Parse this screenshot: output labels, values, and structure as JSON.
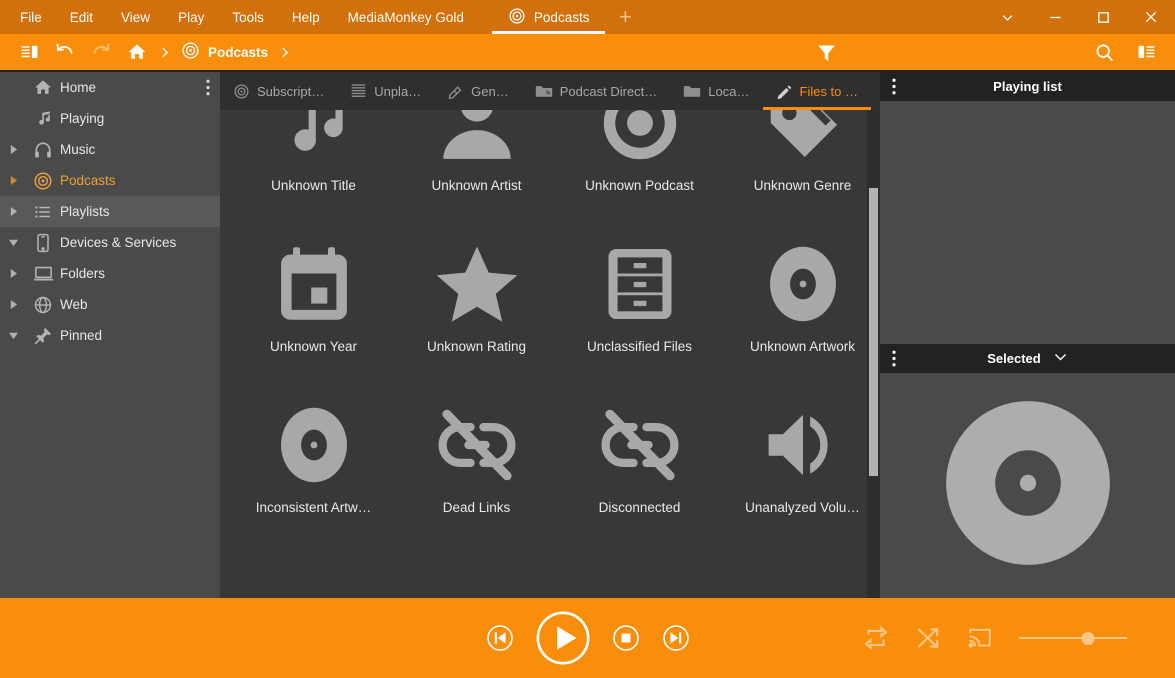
{
  "app": {
    "title": "MediaMonkey Gold",
    "accent": "#f98e0b",
    "menubar_bg": "#d2700a",
    "sidebar_bg": "#4a4a4a",
    "content_bg": "#383838",
    "panel_header_bg": "#222222"
  },
  "menubar": {
    "items": [
      {
        "label": "File",
        "icon": ""
      },
      {
        "label": "Edit",
        "icon": ""
      },
      {
        "label": "View",
        "icon": ""
      },
      {
        "label": "Play",
        "icon": ""
      },
      {
        "label": "Tools",
        "icon": ""
      },
      {
        "label": "Help",
        "icon": ""
      },
      {
        "label": "MediaMonkey Gold",
        "icon": ""
      }
    ],
    "window_tabs": [
      {
        "label": "Podcasts",
        "icon": "podcast-icon",
        "active": true
      }
    ],
    "add_tab_label": "+",
    "window_controls": [
      {
        "name": "chevron-down-icon"
      },
      {
        "name": "minimize-icon"
      },
      {
        "name": "maximize-icon"
      },
      {
        "name": "close-icon"
      }
    ]
  },
  "toolbar": {
    "panel_toggle_icon": "left-panel-toggle-icon",
    "undo_icon": "undo-icon",
    "redo_icon": "redo-icon",
    "home_icon": "home-icon",
    "breadcrumb": [
      {
        "label": "Podcasts",
        "icon": "podcast-icon"
      }
    ],
    "filter_icon": "filter-funnel-icon",
    "search_icon": "search-icon",
    "right_panel_toggle_icon": "right-panel-toggle-icon"
  },
  "sidebar": {
    "kebab_icon": "more-vertical-icon",
    "items": [
      {
        "label": "Home",
        "icon": "home-icon",
        "arrow": "none",
        "state": "normal"
      },
      {
        "label": "Playing",
        "icon": "music-note-icon",
        "arrow": "none",
        "state": "normal"
      },
      {
        "label": "Music",
        "icon": "headphones-icon",
        "arrow": "collapsed",
        "state": "normal"
      },
      {
        "label": "Podcasts",
        "icon": "podcast-icon",
        "arrow": "collapsed",
        "state": "active"
      },
      {
        "label": "Playlists",
        "icon": "list-icon",
        "arrow": "collapsed",
        "state": "selected"
      },
      {
        "label": "Devices & Services",
        "icon": "phone-icon",
        "arrow": "expanded",
        "state": "normal"
      },
      {
        "label": "Folders",
        "icon": "folder-laptop-icon",
        "arrow": "collapsed",
        "state": "normal"
      },
      {
        "label": "Web",
        "icon": "globe-icon",
        "arrow": "collapsed",
        "state": "normal"
      },
      {
        "label": "Pinned",
        "icon": "pin-icon",
        "arrow": "expanded",
        "state": "normal"
      }
    ]
  },
  "content": {
    "tabs": [
      {
        "label": "Subscript…",
        "icon": "podcast-icon",
        "active": false
      },
      {
        "label": "Unpla…",
        "icon": "lines-icon",
        "active": false
      },
      {
        "label": "Gen…",
        "icon": "pencil-tag-icon",
        "active": false
      },
      {
        "label": "Podcast Direct…",
        "icon": "folder-podcast-icon",
        "active": false
      },
      {
        "label": "Loca…",
        "icon": "folder-icon",
        "active": false
      },
      {
        "label": "Files to …",
        "icon": "pencil-icon",
        "active": true
      }
    ],
    "tiles": [
      {
        "label": "Unknown Title",
        "icon": "music-note-icon"
      },
      {
        "label": "Unknown Artist",
        "icon": "artist-icon"
      },
      {
        "label": "Unknown Podcast",
        "icon": "podcast-icon"
      },
      {
        "label": "Unknown Genre",
        "icon": "genre-tag-icon"
      },
      {
        "label": "Unknown Year",
        "icon": "calendar-icon"
      },
      {
        "label": "Unknown Rating",
        "icon": "star-icon"
      },
      {
        "label": "Unclassified Files",
        "icon": "file-cabinet-icon"
      },
      {
        "label": "Unknown Artwork",
        "icon": "disc-icon"
      },
      {
        "label": "Inconsistent Artw…",
        "icon": "disc-icon"
      },
      {
        "label": "Dead Links",
        "icon": "broken-link-icon"
      },
      {
        "label": "Disconnected",
        "icon": "broken-link-icon"
      },
      {
        "label": "Unanalyzed Volu…",
        "icon": "speaker-icon"
      }
    ],
    "scrollbar_name": "content-vertical-scrollbar"
  },
  "right_panel": {
    "playing_list": {
      "title": "Playing list",
      "kebab_icon": "more-vertical-icon",
      "items": []
    },
    "selected": {
      "title": "Selected",
      "kebab_icon": "more-vertical-icon",
      "chevron_icon": "chevron-down-icon",
      "artwork_icon": "disc-placeholder-icon"
    }
  },
  "player": {
    "previous_icon": "skip-previous-icon",
    "play_icon": "play-icon",
    "stop_icon": "stop-icon",
    "next_icon": "skip-next-icon",
    "repeat_icon": "repeat-icon",
    "shuffle_icon": "shuffle-icon",
    "cast_icon": "cast-icon",
    "volume_icon": "volume-slider",
    "volume_percent": 64
  }
}
